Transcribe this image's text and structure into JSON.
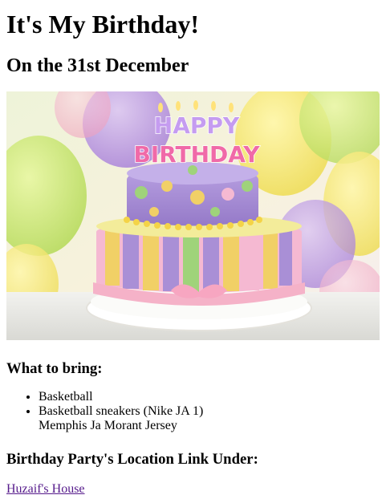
{
  "page": {
    "title": "It's My Birthday!",
    "subtitle": "On the 31st December",
    "cake_image": {
      "topper_line1": "HAPPY",
      "topper_line2": "BIRTHDAY"
    },
    "bring": {
      "heading": "What to bring:",
      "items": [
        {
          "text": "Basketball"
        },
        {
          "text": "Basketball sneakers (Nike JA 1)",
          "continued": "Memphis Ja Morant Jersey"
        }
      ]
    },
    "party": {
      "heading": "Birthday Party's Location Link Under:",
      "link_text": "Huzaif's House"
    }
  },
  "colors": {
    "link": "#551a8b",
    "cake_top": "#a98fd6",
    "cake_bottom_stripes": [
      "#f1d066",
      "#9fd37a",
      "#a98fd6",
      "#f5b9d2"
    ],
    "ribbon": "#f5b2c8"
  }
}
